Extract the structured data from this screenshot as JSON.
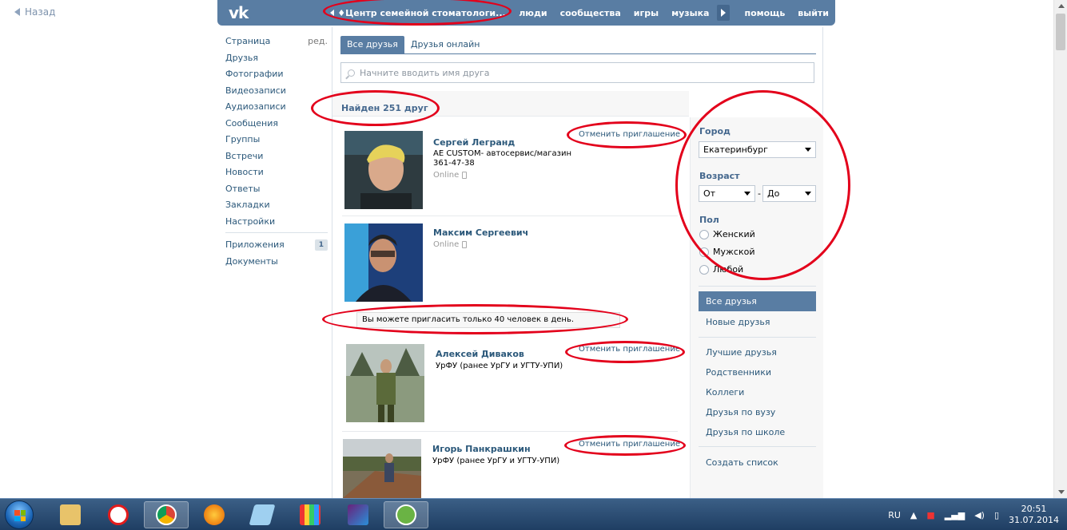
{
  "back": {
    "label": "Назад"
  },
  "header": {
    "logo": "vk",
    "current": "♦Центр семейной стоматологи...",
    "nav": [
      "люди",
      "сообщества",
      "игры",
      "музыка"
    ],
    "nav_right": [
      "помощь",
      "выйти"
    ]
  },
  "sidebar": {
    "items": [
      {
        "label": "Страница",
        "extra": "ред."
      },
      {
        "label": "Друзья"
      },
      {
        "label": "Фотографии"
      },
      {
        "label": "Видеозаписи"
      },
      {
        "label": "Аудиозаписи"
      },
      {
        "label": "Сообщения"
      },
      {
        "label": "Группы"
      },
      {
        "label": "Встречи"
      },
      {
        "label": "Новости"
      },
      {
        "label": "Ответы"
      },
      {
        "label": "Закладки"
      },
      {
        "label": "Настройки"
      }
    ],
    "apps": {
      "label": "Приложения",
      "badge": "1"
    },
    "docs": {
      "label": "Документы"
    }
  },
  "tabs": [
    "Все друзья",
    "Друзья онлайн"
  ],
  "search": {
    "placeholder": "Начните вводить имя друга"
  },
  "found": "Найден 251 друг",
  "friends": [
    {
      "name": "Сергей Легранд",
      "info1": "AE CUSTOM- автосервис/магазин",
      "info2": "361-47-38",
      "online": "Online",
      "cancel": "Отменить приглашение"
    },
    {
      "name": "Максим Сергеевич",
      "online": "Online"
    },
    {
      "name": "Алексей Диваков",
      "info1": "УрФУ (ранее УрГУ и УГТУ-УПИ)",
      "cancel": "Отменить приглашение"
    },
    {
      "name": "Игорь Панкрашкин",
      "info1": "УрФУ (ранее УрГУ и УГТУ-УПИ)",
      "cancel": "Отменить приглашение"
    }
  ],
  "notice": "Вы можете пригласить только 40 человек в день.",
  "filter": {
    "city_label": "Город",
    "city_value": "Екатеринбург",
    "age_label": "Возраст",
    "age_from": "От",
    "age_sep": "-",
    "age_to": "До",
    "sex_label": "Пол",
    "sex_options": [
      "Женский",
      "Мужской",
      "Любой"
    ],
    "lists": [
      "Все друзья",
      "Новые друзья",
      "Лучшие друзья",
      "Родственники",
      "Коллеги",
      "Друзья по вузу",
      "Друзья по школе",
      "Создать список"
    ]
  },
  "taskbar": {
    "lang": "RU",
    "time": "20:51",
    "date": "31.07.2014"
  },
  "colors": {
    "vk_blue": "#597da3",
    "link": "#2b587a",
    "annotation": "#e3001b"
  }
}
